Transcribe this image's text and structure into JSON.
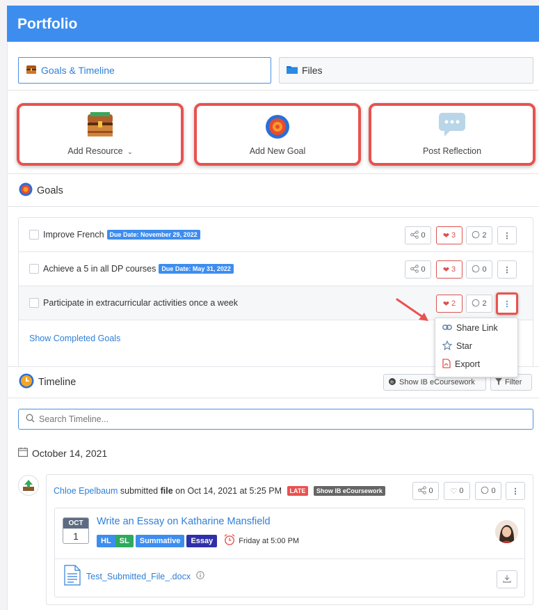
{
  "header": {
    "title": "Portfolio"
  },
  "tabs": [
    {
      "label": "Goals & Timeline",
      "icon": "treasure-chest-icon"
    },
    {
      "label": "Files",
      "icon": "folder-icon"
    }
  ],
  "actions": [
    {
      "label": "Add Resource",
      "icon": "treasure-chest-icon",
      "has_dropdown": true
    },
    {
      "label": "Add New Goal",
      "icon": "target-icon"
    },
    {
      "label": "Post Reflection",
      "icon": "speech-bubble-icon"
    }
  ],
  "goals": {
    "title": "Goals",
    "items": [
      {
        "text": "Improve French",
        "due": "Due Date: November 29, 2022",
        "shares": "0",
        "likes": "3",
        "comments": "2"
      },
      {
        "text": "Achieve a 5 in all DP courses",
        "due": "Due Date: May 31, 2022",
        "shares": "0",
        "likes": "3",
        "comments": "0"
      },
      {
        "text": "Participate in extracurricular activities once a week",
        "due": "",
        "likes": "2",
        "comments": "2"
      }
    ],
    "show_completed": "Show Completed Goals"
  },
  "dropdown": {
    "items": [
      {
        "label": "Share Link",
        "icon": "link-icon"
      },
      {
        "label": "Star",
        "icon": "star-icon"
      },
      {
        "label": "Export",
        "icon": "pdf-icon"
      }
    ]
  },
  "timeline": {
    "title": "Timeline",
    "show_ib": "Show IB eCoursework",
    "filter": "Filter",
    "search_placeholder": "Search Timeline...",
    "date": "October 14, 2021",
    "entry": {
      "user": "Chloe Epelbaum",
      "submitted": "submitted",
      "item_type": "file",
      "on_text": "on Oct 14, 2021 at 5:25 PM",
      "late_tag": "LATE",
      "ib_tag": "Show IB eCoursework",
      "shares": "0",
      "likes": "0",
      "comments": "0",
      "assignment": {
        "month": "OCT",
        "day": "1",
        "title": "Write an Essay on Katharine Mansfield",
        "badges": [
          {
            "label": "HL",
            "color": "#3d8def"
          },
          {
            "label": "SL",
            "color": "#2eaa5c"
          },
          {
            "label": "Summative",
            "color": "#3d8def"
          },
          {
            "label": "Essay",
            "color": "#2f2fa8"
          }
        ],
        "due_time": "Friday at 5:00 PM"
      },
      "file_name": "Test_Submitted_File_.docx"
    }
  },
  "colors": {
    "header": "#3d8def",
    "highlight": "#e8524f",
    "link": "#2f7fd8"
  }
}
